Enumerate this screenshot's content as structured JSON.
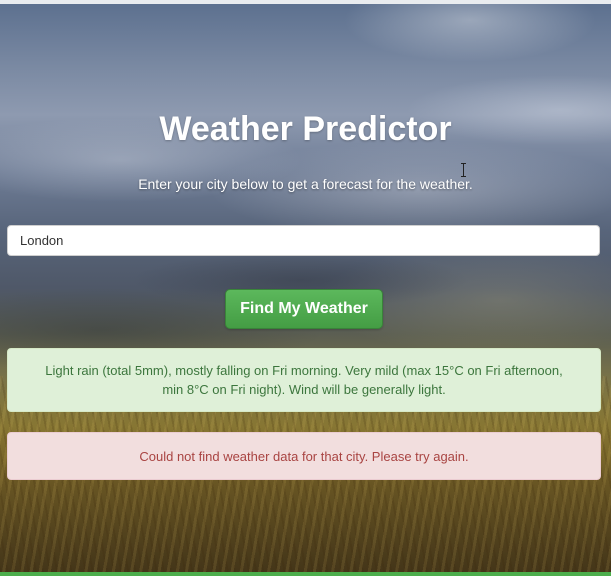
{
  "page": {
    "title": "Weather Predictor",
    "subtitle": "Enter your city below to get a forecast for the weather."
  },
  "form": {
    "city_value": "London",
    "button_label": "Find My Weather"
  },
  "alerts": {
    "success_text": "Light rain (total 5mm), mostly falling on Fri morning. Very mild (max 15°C on Fri afternoon, min 8°C on Fri night). Wind will be generally light.",
    "error_text": "Could not find weather data for that city. Please try again."
  },
  "colors": {
    "button": "#5cb85c",
    "success_bg": "#dff0d8",
    "success_text": "#3c763d",
    "error_bg": "#f2dede",
    "error_text": "#a94442"
  }
}
